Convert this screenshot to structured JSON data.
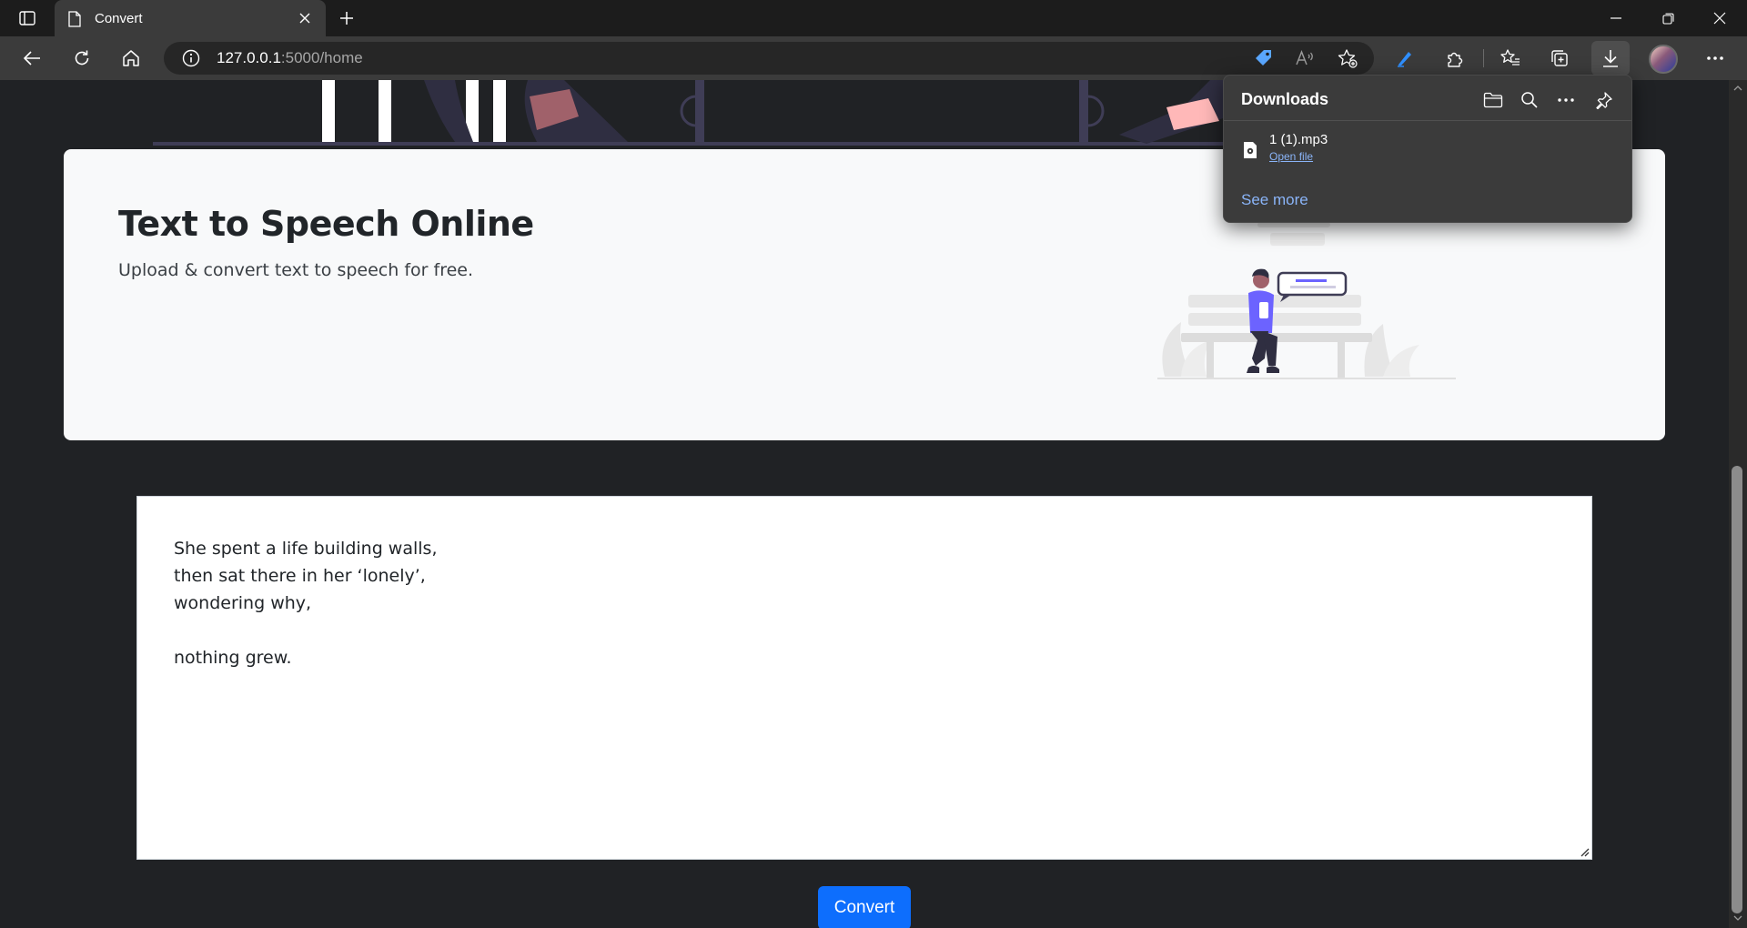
{
  "browser": {
    "tab_title": "Convert",
    "url_host": "127.0.0.1",
    "url_path": ":5000/home"
  },
  "hero": {
    "title": "Text to Speech Online",
    "subtitle": "Upload & convert text to speech for free."
  },
  "editor": {
    "lines": [
      "She spent a life building walls,",
      "then sat there in her ‘lonely’,",
      "wondering why,",
      "",
      "nothing grew."
    ]
  },
  "convert_button": {
    "label": "Convert"
  },
  "downloads": {
    "title": "Downloads",
    "items": [
      {
        "filename": "1 (1).mp3",
        "action": "Open file"
      }
    ],
    "see_more": "See more"
  },
  "colors": {
    "page_bg": "#202225",
    "hero_bg": "#f8f9fa",
    "primary_button": "#0d6efd",
    "link": "#8ab4f8",
    "illustration_accent": "#6c63ff"
  }
}
